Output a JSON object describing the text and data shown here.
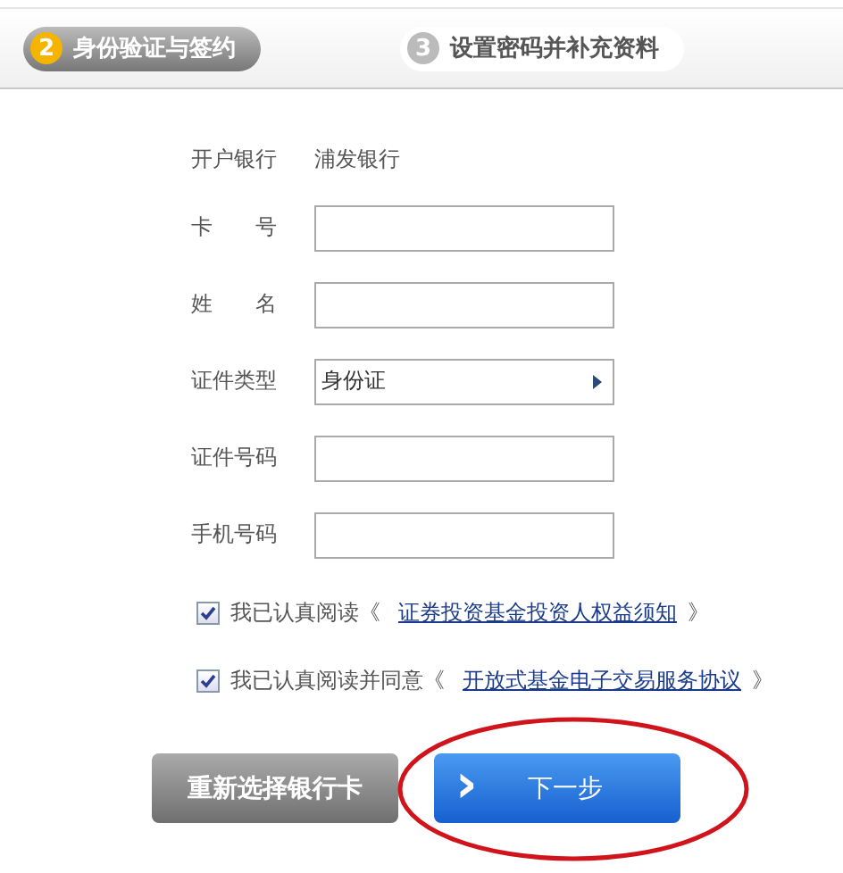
{
  "steps": [
    {
      "number": "2",
      "label": "身份验证与签约",
      "selected": true
    },
    {
      "number": "3",
      "label": "设置密码并补充资料",
      "selected": false
    }
  ],
  "form": [
    {
      "kind": "text",
      "label": "开户银行",
      "value": "浦发银行"
    },
    {
      "kind": "input",
      "label": "卡　　号"
    },
    {
      "kind": "input",
      "label": "姓　　名"
    },
    {
      "kind": "select",
      "label": "证件类型",
      "value": "身份证"
    },
    {
      "kind": "input",
      "label": "证件号码"
    },
    {
      "kind": "input",
      "label": "手机号码"
    }
  ],
  "agreements": [
    {
      "text": "我已认真阅读《",
      "link": "证券投资基金投资人权益须知",
      "close": "》",
      "checked": true
    },
    {
      "text": "我已认真阅读并同意《",
      "link": "开放式基金电子交易服务协议",
      "close": "》",
      "checked": true
    }
  ],
  "buttons": [
    {
      "kind": "secondary",
      "label": "重新选择银行卡"
    },
    {
      "kind": "primary",
      "label": "下一步",
      "icon": "›",
      "highlighted": true
    }
  ]
}
